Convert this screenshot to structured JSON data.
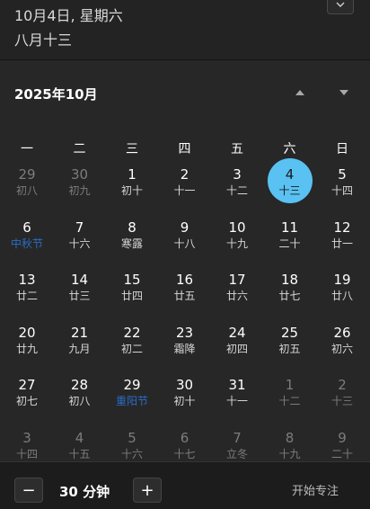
{
  "header": {
    "date_text": "10月4日, 星期六",
    "lunar_text": "八月十三"
  },
  "calendar": {
    "month_title": "2025年10月",
    "weekdays": [
      "一",
      "二",
      "三",
      "四",
      "五",
      "六",
      "日"
    ],
    "today": {
      "day": "4",
      "lunar": "十三"
    },
    "weeks": [
      [
        {
          "day": "29",
          "lunar": "初八",
          "dim": true
        },
        {
          "day": "30",
          "lunar": "初九",
          "dim": true
        },
        {
          "day": "1",
          "lunar": "初十"
        },
        {
          "day": "2",
          "lunar": "十一"
        },
        {
          "day": "3",
          "lunar": "十二"
        },
        {
          "day": "4",
          "lunar": "十三",
          "today": true
        },
        {
          "day": "5",
          "lunar": "十四"
        }
      ],
      [
        {
          "day": "6",
          "lunar": "中秋节",
          "festival": true
        },
        {
          "day": "7",
          "lunar": "十六"
        },
        {
          "day": "8",
          "lunar": "寒露"
        },
        {
          "day": "9",
          "lunar": "十八"
        },
        {
          "day": "10",
          "lunar": "十九"
        },
        {
          "day": "11",
          "lunar": "二十"
        },
        {
          "day": "12",
          "lunar": "廿一"
        }
      ],
      [
        {
          "day": "13",
          "lunar": "廿二"
        },
        {
          "day": "14",
          "lunar": "廿三"
        },
        {
          "day": "15",
          "lunar": "廿四"
        },
        {
          "day": "16",
          "lunar": "廿五"
        },
        {
          "day": "17",
          "lunar": "廿六"
        },
        {
          "day": "18",
          "lunar": "廿七"
        },
        {
          "day": "19",
          "lunar": "廿八"
        }
      ],
      [
        {
          "day": "20",
          "lunar": "廿九"
        },
        {
          "day": "21",
          "lunar": "九月"
        },
        {
          "day": "22",
          "lunar": "初二"
        },
        {
          "day": "23",
          "lunar": "霜降"
        },
        {
          "day": "24",
          "lunar": "初四"
        },
        {
          "day": "25",
          "lunar": "初五"
        },
        {
          "day": "26",
          "lunar": "初六"
        }
      ],
      [
        {
          "day": "27",
          "lunar": "初七"
        },
        {
          "day": "28",
          "lunar": "初八"
        },
        {
          "day": "29",
          "lunar": "重阳节",
          "festival": true
        },
        {
          "day": "30",
          "lunar": "初十"
        },
        {
          "day": "31",
          "lunar": "十一"
        },
        {
          "day": "1",
          "lunar": "十二",
          "dim": true
        },
        {
          "day": "2",
          "lunar": "十三",
          "dim": true
        }
      ],
      [
        {
          "day": "3",
          "lunar": "十四",
          "dim": true
        },
        {
          "day": "4",
          "lunar": "十五",
          "dim": true
        },
        {
          "day": "5",
          "lunar": "十六",
          "dim": true
        },
        {
          "day": "6",
          "lunar": "十七",
          "dim": true
        },
        {
          "day": "7",
          "lunar": "立冬",
          "dim": true
        },
        {
          "day": "8",
          "lunar": "十九",
          "dim": true
        },
        {
          "day": "9",
          "lunar": "二十",
          "dim": true
        }
      ]
    ]
  },
  "focus": {
    "minus_label": "−",
    "duration": "30 分钟",
    "plus_label": "+",
    "start_label": "开始专注"
  },
  "colors": {
    "accent": "#5ac1f3",
    "festival": "#2a6cc6",
    "background": "#202020"
  }
}
